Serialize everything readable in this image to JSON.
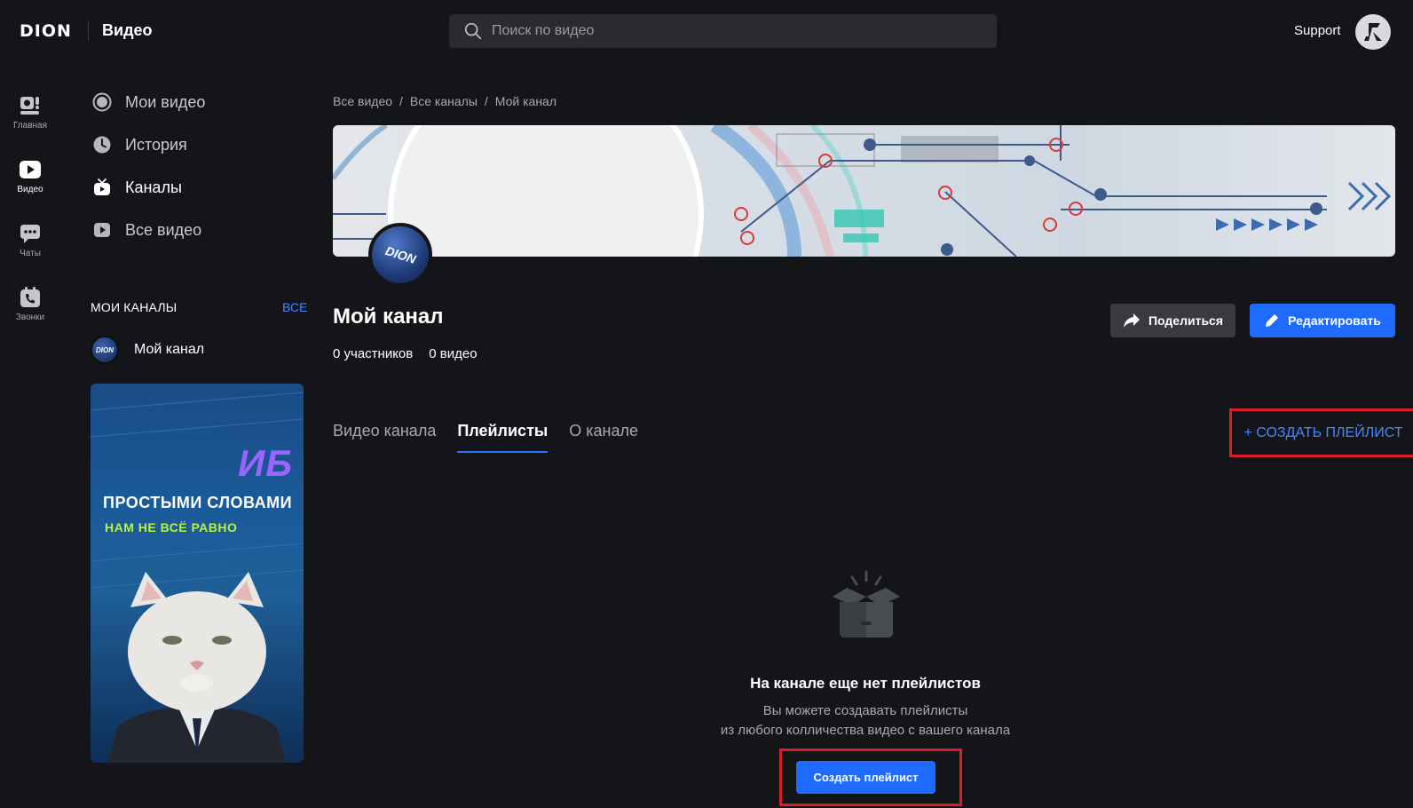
{
  "header": {
    "logo": "DION",
    "app_title": "Видео",
    "search_placeholder": "Поиск по видео",
    "support": "Support"
  },
  "rail": [
    {
      "label": "Главная",
      "icon": "home-icon"
    },
    {
      "label": "Видео",
      "icon": "video-icon"
    },
    {
      "label": "Чаты",
      "icon": "chat-icon"
    },
    {
      "label": "Звонки",
      "icon": "calls-icon"
    }
  ],
  "nav": [
    {
      "label": "Мои видео",
      "icon": "record-icon"
    },
    {
      "label": "История",
      "icon": "clock-icon"
    },
    {
      "label": "Каналы",
      "icon": "tv-icon"
    },
    {
      "label": "Все видео",
      "icon": "play-icon"
    }
  ],
  "my_channels": {
    "title": "МОИ КАНАЛЫ",
    "all_link": "ВСЕ",
    "items": [
      {
        "name": "Мой канал",
        "avatar_text": "DION"
      }
    ]
  },
  "promo": {
    "headline": "ИБ",
    "line1": "ПРОСТЫМИ СЛОВАМИ",
    "line2": "НАМ НЕ ВСЁ РАВНО"
  },
  "breadcrumbs": [
    "Все видео",
    "Все каналы",
    "Мой канал"
  ],
  "channel": {
    "avatar_text": "DION",
    "title": "Мой канал",
    "members": "0 участников",
    "videos": "0 видео",
    "share_label": "Поделиться",
    "edit_label": "Редактировать"
  },
  "tabs": [
    {
      "label": "Видео канала",
      "active": false
    },
    {
      "label": "Плейлисты",
      "active": true
    },
    {
      "label": "О канале",
      "active": false
    }
  ],
  "create_playlist_link": "+ СОЗДАТЬ ПЛЕЙЛИСТ",
  "empty_state": {
    "title": "На канале еще нет плейлистов",
    "subtitle_line1": "Вы можете создавать плейлисты",
    "subtitle_line2": "из любого колличества видео с вашего канала",
    "button_label": "Создать плейлист"
  },
  "colors": {
    "background": "#141519",
    "accent": "#1f6bff",
    "link": "#4a86ff",
    "highlight": "#e01c2a"
  }
}
